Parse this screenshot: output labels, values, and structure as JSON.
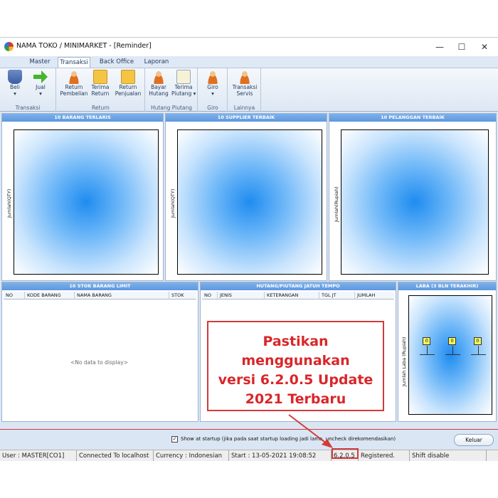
{
  "window": {
    "title": "NAMA TOKO / MINIMARKET - [Reminder]",
    "controls": {
      "minimize": "—",
      "maximize": "☐",
      "close": "✕"
    }
  },
  "tabs": [
    {
      "label": "Master",
      "active": false
    },
    {
      "label": "Transaksi",
      "active": true
    },
    {
      "label": "Back Office",
      "active": false
    },
    {
      "label": "Laporan",
      "active": false
    }
  ],
  "ribbon": {
    "groups": [
      {
        "label": "Transaksi",
        "buttons": [
          {
            "line1": "Beli",
            "line2": "▾",
            "icon": "cart-icon"
          },
          {
            "line1": "Jual",
            "line2": "▾",
            "icon": "arrow-right-icon"
          }
        ]
      },
      {
        "label": "Return",
        "buttons": [
          {
            "line1": "Return",
            "line2": "Pembelian",
            "icon": "person-return-icon"
          },
          {
            "line1": "Terima",
            "line2": "Return",
            "icon": "document-icon"
          },
          {
            "line1": "Return",
            "line2": "Penjualan",
            "icon": "document-return-icon"
          }
        ]
      },
      {
        "label": "Hutang Piutang",
        "buttons": [
          {
            "line1": "Bayar",
            "line2": "Hutang",
            "icon": "person-pay-icon"
          },
          {
            "line1": "Terima",
            "line2": "Piutang ▾",
            "icon": "card-icon"
          }
        ]
      },
      {
        "label": "Giro",
        "buttons": [
          {
            "line1": "Giro",
            "line2": "▾",
            "icon": "person-giro-icon"
          }
        ]
      },
      {
        "label": "Lainnya",
        "buttons": [
          {
            "line1": "Transaksi",
            "line2": "Servis",
            "icon": "person-service-icon"
          }
        ]
      }
    ]
  },
  "panels": {
    "barang_terlaris": {
      "title": "10 BARANG TERLARIS",
      "ylabel": "Jumlah(QTY)"
    },
    "supplier_terbaik": {
      "title": "10 SUPPLIER TERBAIK",
      "ylabel": "Jumlah(QTY)"
    },
    "pelanggan_terbaik": {
      "title": "10 PELANGGAN TERBAIK",
      "ylabel": "Jumlah(Rupiah)"
    },
    "stok_limit": {
      "title": "10 STOK BARANG LIMIT",
      "columns": [
        "NO",
        "KODE BARANG",
        "NAMA BARANG",
        "STOK"
      ],
      "empty": "<No data to display>"
    },
    "hutang_piutang": {
      "title": "HUTANG/PIUTANG JATUH TEMPO",
      "columns": [
        "NO",
        "JENIS",
        "KETERANGAN",
        "TGL JT",
        "JUMLAH"
      ]
    },
    "laba": {
      "title": "LABA (3 BLN TERAKHIR)",
      "ylabel": "Jumlah Laba (Rupiah)",
      "bar_labels": [
        "0",
        "0",
        "0"
      ]
    }
  },
  "chart_data": {
    "type": "bar",
    "title": "LABA (3 BLN TERAKHIR)",
    "xlabel": "",
    "ylabel": "Jumlah Laba (Rupiah)",
    "categories": [],
    "values": [
      0,
      0,
      0
    ]
  },
  "footer": {
    "checkbox_checked": true,
    "checkbox_mark": "✓",
    "checkbox_label": "Show at startup (jika pada saat startup loading jadi lama, uncheck direkomendasikan)",
    "close_button": "Keluar"
  },
  "statusbar": {
    "user": "User : MASTER[CO1]",
    "connection": "Connected To localhost",
    "currency": "Currency : Indonesian",
    "start": "Start   : 13-05-2021 19:08:52",
    "version": "6.2.0.5",
    "registration": "Registered.",
    "shift": "Shift disable"
  },
  "promo": {
    "lines": [
      "Pastikan menggunakan",
      "versi 6.2.0.5 Update",
      "2021 Terbaru"
    ]
  },
  "colors": {
    "accent": "#5d98df",
    "promo_red": "#d9262a",
    "window_bg": "#dbe6f4"
  }
}
